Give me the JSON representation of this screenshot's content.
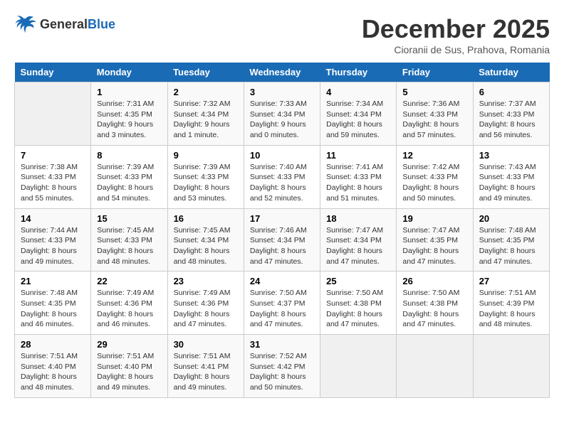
{
  "logo": {
    "line1": "General",
    "line2": "Blue"
  },
  "title": "December 2025",
  "location": "Cioranii de Sus, Prahova, Romania",
  "days_of_week": [
    "Sunday",
    "Monday",
    "Tuesday",
    "Wednesday",
    "Thursday",
    "Friday",
    "Saturday"
  ],
  "weeks": [
    [
      {
        "day": "",
        "info": ""
      },
      {
        "day": "1",
        "info": "Sunrise: 7:31 AM\nSunset: 4:35 PM\nDaylight: 9 hours\nand 3 minutes."
      },
      {
        "day": "2",
        "info": "Sunrise: 7:32 AM\nSunset: 4:34 PM\nDaylight: 9 hours\nand 1 minute."
      },
      {
        "day": "3",
        "info": "Sunrise: 7:33 AM\nSunset: 4:34 PM\nDaylight: 9 hours\nand 0 minutes."
      },
      {
        "day": "4",
        "info": "Sunrise: 7:34 AM\nSunset: 4:34 PM\nDaylight: 8 hours\nand 59 minutes."
      },
      {
        "day": "5",
        "info": "Sunrise: 7:36 AM\nSunset: 4:33 PM\nDaylight: 8 hours\nand 57 minutes."
      },
      {
        "day": "6",
        "info": "Sunrise: 7:37 AM\nSunset: 4:33 PM\nDaylight: 8 hours\nand 56 minutes."
      }
    ],
    [
      {
        "day": "7",
        "info": "Sunrise: 7:38 AM\nSunset: 4:33 PM\nDaylight: 8 hours\nand 55 minutes."
      },
      {
        "day": "8",
        "info": "Sunrise: 7:39 AM\nSunset: 4:33 PM\nDaylight: 8 hours\nand 54 minutes."
      },
      {
        "day": "9",
        "info": "Sunrise: 7:39 AM\nSunset: 4:33 PM\nDaylight: 8 hours\nand 53 minutes."
      },
      {
        "day": "10",
        "info": "Sunrise: 7:40 AM\nSunset: 4:33 PM\nDaylight: 8 hours\nand 52 minutes."
      },
      {
        "day": "11",
        "info": "Sunrise: 7:41 AM\nSunset: 4:33 PM\nDaylight: 8 hours\nand 51 minutes."
      },
      {
        "day": "12",
        "info": "Sunrise: 7:42 AM\nSunset: 4:33 PM\nDaylight: 8 hours\nand 50 minutes."
      },
      {
        "day": "13",
        "info": "Sunrise: 7:43 AM\nSunset: 4:33 PM\nDaylight: 8 hours\nand 49 minutes."
      }
    ],
    [
      {
        "day": "14",
        "info": "Sunrise: 7:44 AM\nSunset: 4:33 PM\nDaylight: 8 hours\nand 49 minutes."
      },
      {
        "day": "15",
        "info": "Sunrise: 7:45 AM\nSunset: 4:33 PM\nDaylight: 8 hours\nand 48 minutes."
      },
      {
        "day": "16",
        "info": "Sunrise: 7:45 AM\nSunset: 4:34 PM\nDaylight: 8 hours\nand 48 minutes."
      },
      {
        "day": "17",
        "info": "Sunrise: 7:46 AM\nSunset: 4:34 PM\nDaylight: 8 hours\nand 47 minutes."
      },
      {
        "day": "18",
        "info": "Sunrise: 7:47 AM\nSunset: 4:34 PM\nDaylight: 8 hours\nand 47 minutes."
      },
      {
        "day": "19",
        "info": "Sunrise: 7:47 AM\nSunset: 4:35 PM\nDaylight: 8 hours\nand 47 minutes."
      },
      {
        "day": "20",
        "info": "Sunrise: 7:48 AM\nSunset: 4:35 PM\nDaylight: 8 hours\nand 47 minutes."
      }
    ],
    [
      {
        "day": "21",
        "info": "Sunrise: 7:48 AM\nSunset: 4:35 PM\nDaylight: 8 hours\nand 46 minutes."
      },
      {
        "day": "22",
        "info": "Sunrise: 7:49 AM\nSunset: 4:36 PM\nDaylight: 8 hours\nand 46 minutes."
      },
      {
        "day": "23",
        "info": "Sunrise: 7:49 AM\nSunset: 4:36 PM\nDaylight: 8 hours\nand 47 minutes."
      },
      {
        "day": "24",
        "info": "Sunrise: 7:50 AM\nSunset: 4:37 PM\nDaylight: 8 hours\nand 47 minutes."
      },
      {
        "day": "25",
        "info": "Sunrise: 7:50 AM\nSunset: 4:38 PM\nDaylight: 8 hours\nand 47 minutes."
      },
      {
        "day": "26",
        "info": "Sunrise: 7:50 AM\nSunset: 4:38 PM\nDaylight: 8 hours\nand 47 minutes."
      },
      {
        "day": "27",
        "info": "Sunrise: 7:51 AM\nSunset: 4:39 PM\nDaylight: 8 hours\nand 48 minutes."
      }
    ],
    [
      {
        "day": "28",
        "info": "Sunrise: 7:51 AM\nSunset: 4:40 PM\nDaylight: 8 hours\nand 48 minutes."
      },
      {
        "day": "29",
        "info": "Sunrise: 7:51 AM\nSunset: 4:40 PM\nDaylight: 8 hours\nand 49 minutes."
      },
      {
        "day": "30",
        "info": "Sunrise: 7:51 AM\nSunset: 4:41 PM\nDaylight: 8 hours\nand 49 minutes."
      },
      {
        "day": "31",
        "info": "Sunrise: 7:52 AM\nSunset: 4:42 PM\nDaylight: 8 hours\nand 50 minutes."
      },
      {
        "day": "",
        "info": ""
      },
      {
        "day": "",
        "info": ""
      },
      {
        "day": "",
        "info": ""
      }
    ]
  ]
}
